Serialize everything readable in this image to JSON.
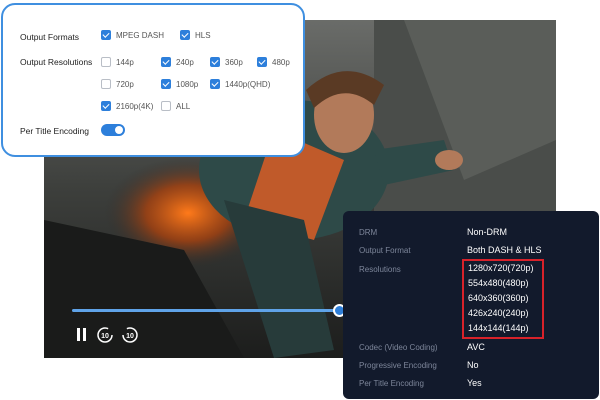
{
  "settings": {
    "output_formats": {
      "label": "Output Formats",
      "options": [
        {
          "label": "MPEG DASH",
          "checked": true
        },
        {
          "label": "HLS",
          "checked": true
        }
      ]
    },
    "output_resolutions": {
      "label": "Output Resolutions",
      "options": [
        {
          "label": "144p",
          "checked": false
        },
        {
          "label": "240p",
          "checked": true
        },
        {
          "label": "360p",
          "checked": true
        },
        {
          "label": "480p",
          "checked": true
        },
        {
          "label": "720p",
          "checked": false
        },
        {
          "label": "1080p",
          "checked": true
        },
        {
          "label": "1440p(QHD)",
          "checked": true
        },
        {
          "label": "2160p(4K)",
          "checked": true
        },
        {
          "label": "ALL",
          "checked": false
        }
      ]
    },
    "per_title_encoding": {
      "label": "Per Title Encoding",
      "enabled": true
    }
  },
  "info": {
    "rows": [
      {
        "key": "DRM",
        "value": "Non-DRM"
      },
      {
        "key": "Output Format",
        "value": "Both DASH & HLS"
      },
      {
        "key": "Resolutions",
        "value": ""
      },
      {
        "key": "Codec (Video Coding)",
        "value": "AVC"
      },
      {
        "key": "Progressive Encoding",
        "value": "No"
      },
      {
        "key": "Per Title Encoding",
        "value": "Yes"
      }
    ],
    "resolutions": [
      "1280x720(720p)",
      "554x480(480p)",
      "640x360(360p)",
      "426x240(240p)",
      "144x144(144p)"
    ]
  },
  "player": {
    "skip_back_label": "10",
    "skip_forward_label": "10",
    "progress": 0.55
  },
  "colors": {
    "accent": "#2d7fdb",
    "highlight": "#d8222a",
    "panel_dark": "#121a2c"
  }
}
